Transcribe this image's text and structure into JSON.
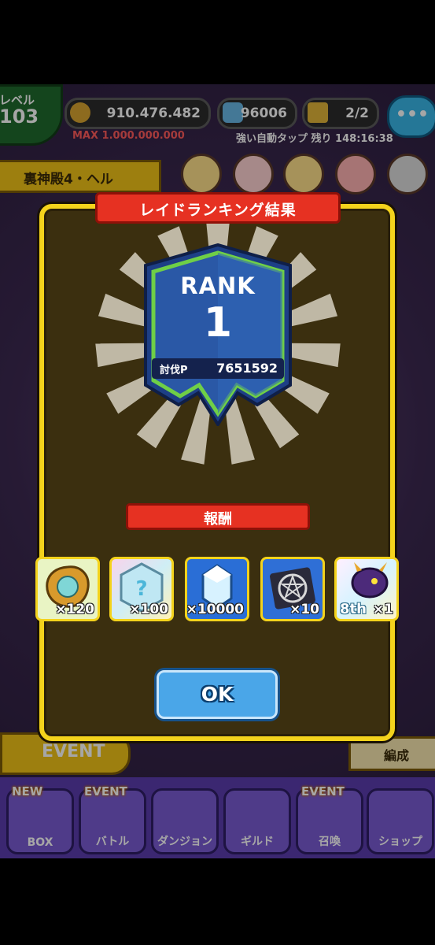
{
  "hud": {
    "level_label": "レベル",
    "level_value": "103",
    "coins": "910.476.482",
    "gems": "96006",
    "tickets": "2/2",
    "max_text": "MAX 1.000.000.000",
    "auto_tap_text": "強い自動タップ 残り 148:16:38",
    "area_title": "裏神殿4・ヘル",
    "chat_icon": "•••"
  },
  "dialog": {
    "title": "レイドランキング結果",
    "rank_label": "RANK",
    "rank_value": "1",
    "score_label": "討伐P",
    "score_value": "7651592",
    "reward_title": "報酬",
    "rewards": [
      {
        "icon": "gold-badge-icon",
        "qty": "×120"
      },
      {
        "icon": "mystery-gem-icon",
        "qty": "×100"
      },
      {
        "icon": "blue-gem-icon",
        "qty": "×10000"
      },
      {
        "icon": "pentagram-icon",
        "qty": "×10"
      },
      {
        "icon": "purple-monster-icon",
        "qty": "×1"
      }
    ],
    "ok_label": "OK",
    "anniv_label": "8th"
  },
  "bottom": {
    "event_banner": "EVENT",
    "hensei": "編成",
    "nav": [
      {
        "label": "BOX",
        "tag": "NEW"
      },
      {
        "label": "バトル",
        "tag": "EVENT"
      },
      {
        "label": "ダンジョン",
        "tag": ""
      },
      {
        "label": "ギルド",
        "tag": ""
      },
      {
        "label": "召喚",
        "tag": "EVENT"
      },
      {
        "label": "ショップ",
        "tag": ""
      }
    ]
  },
  "colors": {
    "dialog_border": "#f4d31c",
    "ribbon_red": "#e63122",
    "shield_blue": "#2a58a6",
    "shield_green": "#6fcf47"
  }
}
